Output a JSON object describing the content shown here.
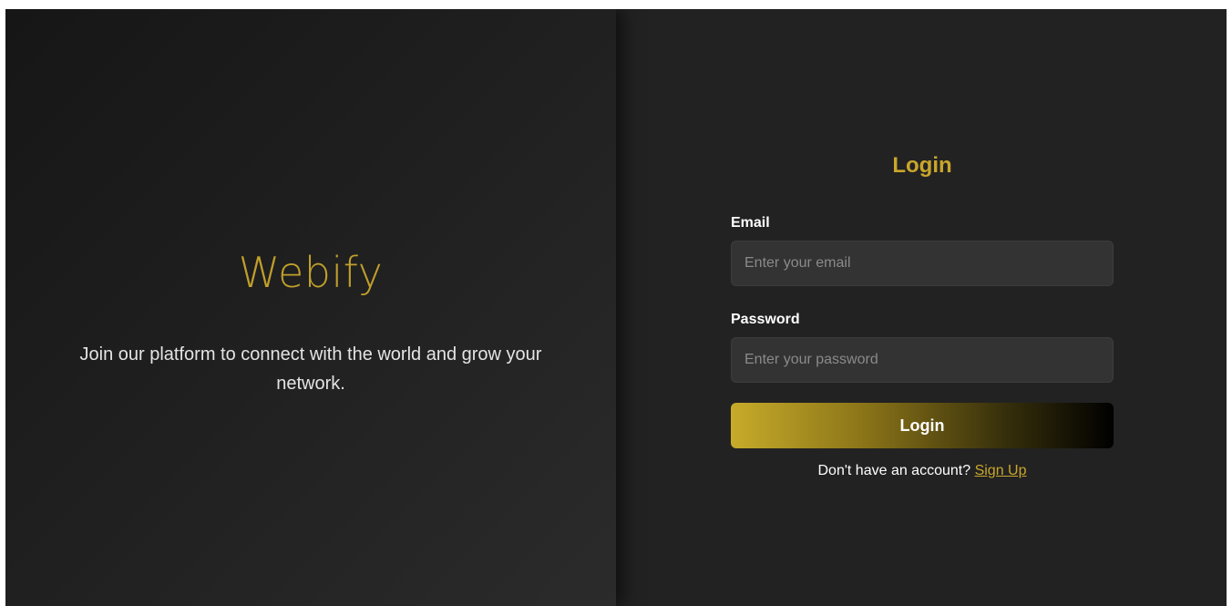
{
  "branding": {
    "name": "Webify",
    "tagline": "Join our platform to connect with the world and grow your network."
  },
  "login_form": {
    "title": "Login",
    "email_label": "Email",
    "email_placeholder": "Enter your email",
    "password_label": "Password",
    "password_placeholder": "Enter your password",
    "submit_label": "Login",
    "signup_prompt": "Don't have an account?",
    "signup_link": "Sign Up"
  },
  "colors": {
    "accent_gold": "#c9a62c",
    "panel_dark": "#222222",
    "input_background": "#333333"
  }
}
